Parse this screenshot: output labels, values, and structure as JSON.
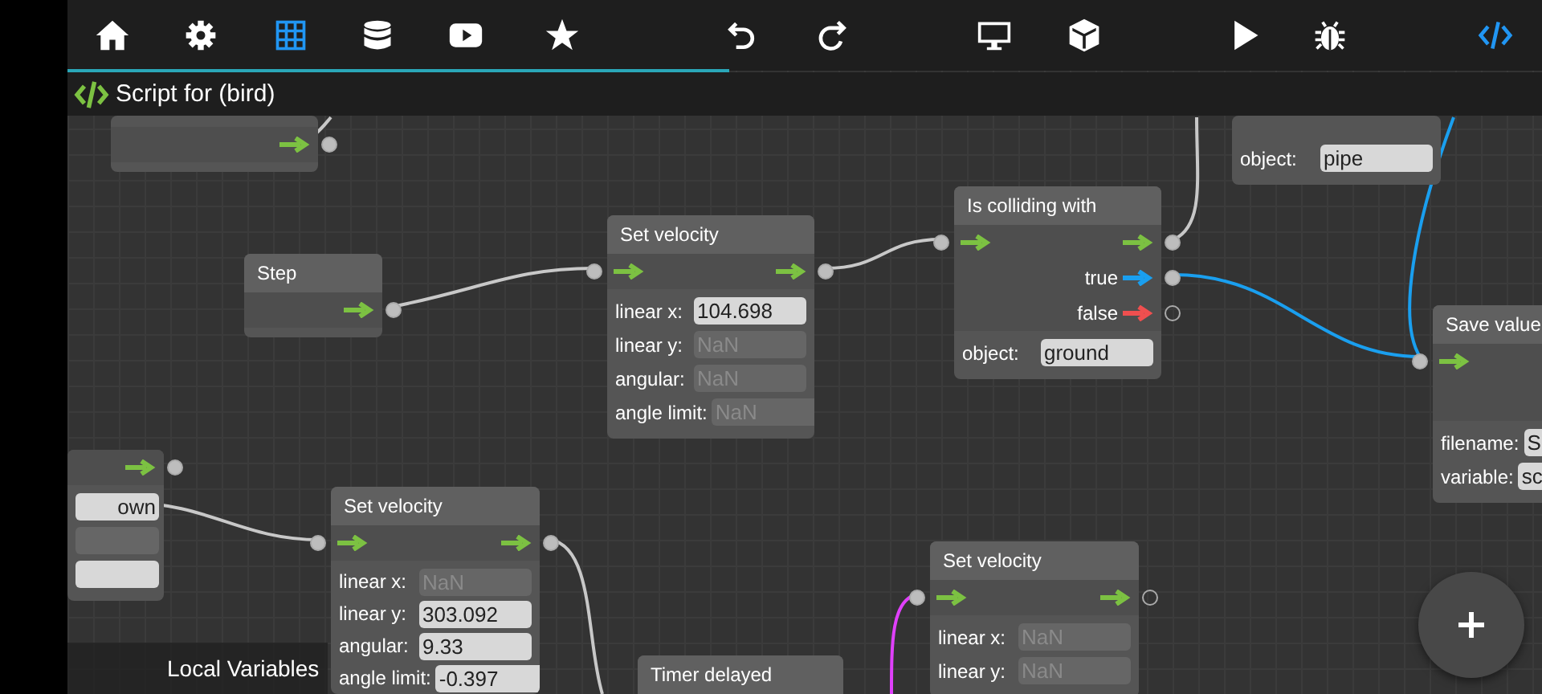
{
  "toolbar": [
    {
      "selected": false
    },
    {
      "selected": false
    },
    {
      "selected": true
    },
    {
      "selected": false
    },
    {
      "selected": false
    },
    {
      "selected": false
    },
    {
      "selected": false
    },
    {
      "selected": false
    },
    {
      "selected": false
    },
    {
      "selected": false
    },
    {
      "selected": false
    },
    {
      "selected": false
    },
    {
      "selected": true
    }
  ],
  "header": {
    "title": "Script for (bird)"
  },
  "nodes": [
    {
      "input": false,
      "outputs": [
        {
          "kind": "flow",
          "color": "#7cc142",
          "connected": true
        }
      ]
    },
    {
      "title": "Step",
      "input": false,
      "outputs": [
        {
          "kind": "flow",
          "color": "#7cc142",
          "connected": true
        }
      ]
    },
    {
      "title": "Set velocity",
      "input": true,
      "outputs": [
        {
          "kind": "flow",
          "color": "#7cc142",
          "connected": true
        }
      ],
      "fields": [
        {
          "label": "linear x:",
          "value": "104.698",
          "disabled": false
        },
        {
          "label": "linear y:",
          "placeholder": "NaN",
          "disabled": true
        },
        {
          "label": "angular:",
          "placeholder": "NaN",
          "disabled": true
        },
        {
          "label": "angle limit:",
          "placeholder": "NaN",
          "disabled": true
        }
      ]
    },
    {
      "title": "Is colliding with",
      "input": true,
      "outputs": [
        {
          "kind": "flow",
          "color": "#7cc142",
          "connected": true
        },
        {
          "kind": "branch",
          "label": "true",
          "color": "#1a9fef",
          "connected": true
        },
        {
          "kind": "branch",
          "label": "false",
          "color": "#ef4f4f",
          "connected": false
        }
      ],
      "fields": [
        {
          "label": "object:",
          "value": "ground",
          "disabled": false
        }
      ]
    },
    {
      "input": false,
      "fields": [
        {
          "label": "object:",
          "value": "pipe",
          "disabled": false
        }
      ]
    },
    {
      "title": "Save value",
      "input": true,
      "fields": [
        {
          "label": "filename:",
          "value": "S",
          "disabled": false
        },
        {
          "label": "variable:",
          "value": "sc",
          "disabled": false
        }
      ]
    },
    {
      "input": false,
      "outputs": [
        {
          "kind": "flow",
          "color": "#7cc142",
          "connected": true
        }
      ],
      "fields": [
        {
          "value": "own",
          "disabled": false
        },
        {
          "disabled": true
        },
        {
          "disabled": false
        }
      ]
    },
    {
      "title": "Set velocity",
      "input": true,
      "outputs": [
        {
          "kind": "flow",
          "color": "#7cc142",
          "connected": true
        }
      ],
      "fields": [
        {
          "label": "linear x:",
          "placeholder": "NaN",
          "disabled": true
        },
        {
          "label": "linear y:",
          "value": "303.092",
          "disabled": false
        },
        {
          "label": "angular:",
          "value": "9.33",
          "disabled": false
        },
        {
          "label": "angle limit:",
          "value": "-0.397",
          "disabled": false
        }
      ]
    },
    {
      "title": "Timer delayed"
    },
    {
      "title": "Set velocity",
      "input": true,
      "outputs": [
        {
          "kind": "flow",
          "color": "#7cc142",
          "connected": false
        }
      ],
      "fields": [
        {
          "label": "linear x:",
          "placeholder": "NaN",
          "disabled": true
        },
        {
          "label": "linear y:",
          "placeholder": "NaN",
          "disabled": true
        }
      ]
    }
  ],
  "local_variables": {
    "label": "Local Variables"
  }
}
